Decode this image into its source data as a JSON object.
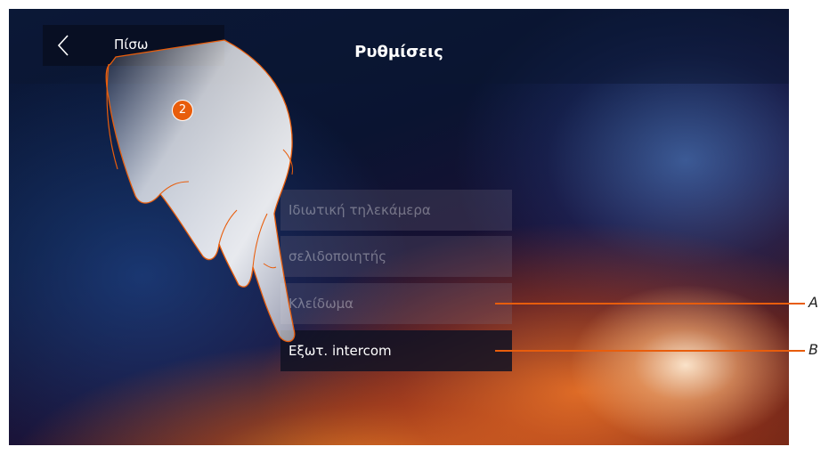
{
  "header": {
    "back_label": "Πίσω",
    "title": "Ρυθμίσεις"
  },
  "menu": {
    "items": [
      {
        "label": "Ιδιωτική τηλεκάμερα"
      },
      {
        "label": "σελιδοποιητής"
      },
      {
        "label": "Κλείδωμα"
      },
      {
        "label": "Εξωτ. intercom"
      }
    ]
  },
  "annotations": {
    "step": "2",
    "callout_a": "A",
    "callout_b": "B"
  },
  "colors": {
    "accent": "#e85d0c",
    "active_item_bg": "#0f1223"
  },
  "icons": {
    "back": "chevron-left-icon",
    "hand": "pointing-hand-icon"
  }
}
